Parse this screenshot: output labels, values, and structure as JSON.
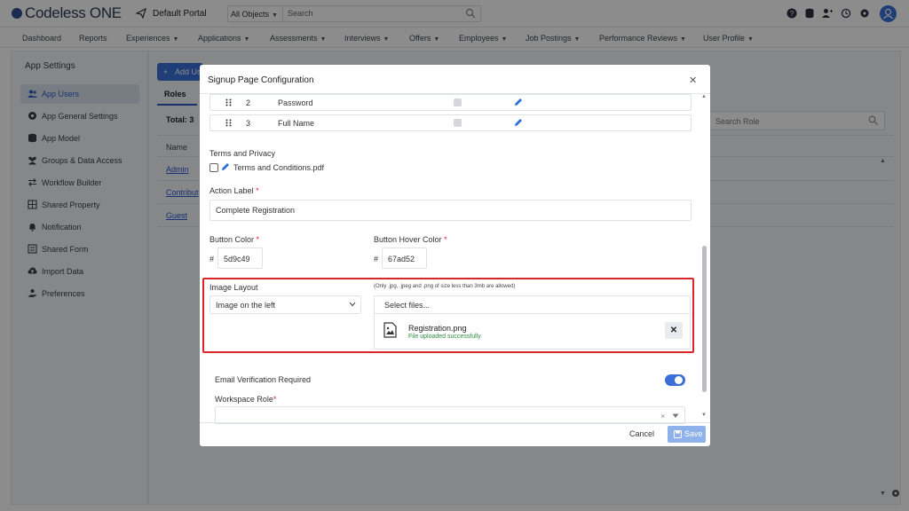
{
  "topbar": {
    "logo": "Codeless ONE",
    "portal": "Default Portal",
    "search_scope": "All Objects",
    "search_placeholder": "Search"
  },
  "menu": [
    "Dashboard",
    "Reports",
    "Experiences",
    "Applications",
    "Assessments",
    "Interviews",
    "Offers",
    "Employees",
    "Job Postings",
    "Performance Reviews",
    "User Profile"
  ],
  "sidebar": {
    "title": "App Settings",
    "items": [
      {
        "label": "App Users",
        "icon": "users-icon",
        "active": true
      },
      {
        "label": "App General Settings",
        "icon": "gear-icon"
      },
      {
        "label": "App Model",
        "icon": "database-icon"
      },
      {
        "label": "Groups & Data Access",
        "icon": "group-icon"
      },
      {
        "label": "Workflow Builder",
        "icon": "arrows-icon"
      },
      {
        "label": "Shared Property",
        "icon": "grid-icon"
      },
      {
        "label": "Notification",
        "icon": "bell-icon"
      },
      {
        "label": "Shared Form",
        "icon": "form-icon"
      },
      {
        "label": "Import Data",
        "icon": "cloud-upload-icon"
      },
      {
        "label": "Preferences",
        "icon": "hand-icon"
      }
    ]
  },
  "main": {
    "add_label": "Add Us",
    "tab": "Roles",
    "total": "Total: 3",
    "col_name": "Name",
    "rows": [
      "Admin",
      "Contribut",
      "Guest"
    ],
    "search_placeholder": "Search Role"
  },
  "modal": {
    "title": "Signup Page Configuration",
    "fields": [
      {
        "num": "2",
        "name": "Password"
      },
      {
        "num": "3",
        "name": "Full Name"
      }
    ],
    "terms_label": "Terms and Privacy",
    "terms_file": "Terms and Conditions.pdf",
    "action_label": "Action Label",
    "action_value": "Complete Registration",
    "button_color_label": "Button Color",
    "button_color": "5d9c49",
    "hover_color_label": "Button Hover Color",
    "hover_color": "67ad52",
    "hash": "#",
    "image_layout_label": "Image Layout",
    "image_layout_value": "Image on the left",
    "upload_hint": "(Only .jpg, .jpeg and .png of size less than 3mb are allowed)",
    "select_files": "Select files...",
    "file_name": "Registration.png",
    "file_status": "File uploaded successfully",
    "email_verification": "Email Verification Required",
    "email_verification_on": true,
    "workspace_role_label": "Workspace Role",
    "cancel": "Cancel",
    "save": "Save",
    "required_mark": "*"
  }
}
